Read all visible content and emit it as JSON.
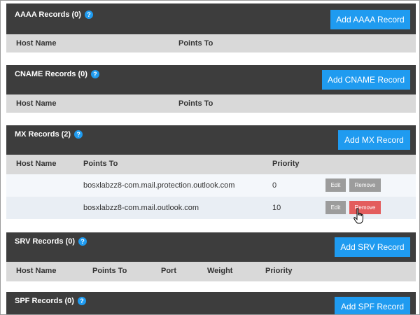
{
  "sections": {
    "aaaa": {
      "title": "AAAA Records (0)",
      "add_label": "Add AAAA Record",
      "columns": [
        "Host Name",
        "Points To"
      ]
    },
    "cname": {
      "title": "CNAME Records (0)",
      "add_label": "Add CNAME Record",
      "columns": [
        "Host Name",
        "Points To"
      ]
    },
    "mx": {
      "title": "MX Records (2)",
      "add_label": "Add MX Record",
      "columns": [
        "Host Name",
        "Points To",
        "Priority"
      ],
      "rows": [
        {
          "host": "",
          "points_to": "bosxlabzz8-com.mail.protection.outlook.com",
          "priority": "0",
          "edit": "Edit",
          "remove": "Remove"
        },
        {
          "host": "",
          "points_to": "bosxlabzz8-com.mail.outlook.com",
          "priority": "10",
          "edit": "Edit",
          "remove": "Remove"
        }
      ]
    },
    "srv": {
      "title": "SRV Records (0)",
      "add_label": "Add SRV Record",
      "columns": [
        "Host Name",
        "Points To",
        "Port",
        "Weight",
        "Priority"
      ]
    },
    "spf": {
      "title": "SPF Records (0)",
      "add_label": "Add SPF Record"
    }
  },
  "help_glyph": "?",
  "colors": {
    "header_bg": "#3d3d3d",
    "accent": "#1f9bf0",
    "column_header_bg": "#d9d9d9",
    "button_gray": "#9c9c9c",
    "remove_hover": "#e35d5d"
  },
  "icons": {
    "help": "help-icon",
    "cursor": "hand-pointer-icon"
  }
}
